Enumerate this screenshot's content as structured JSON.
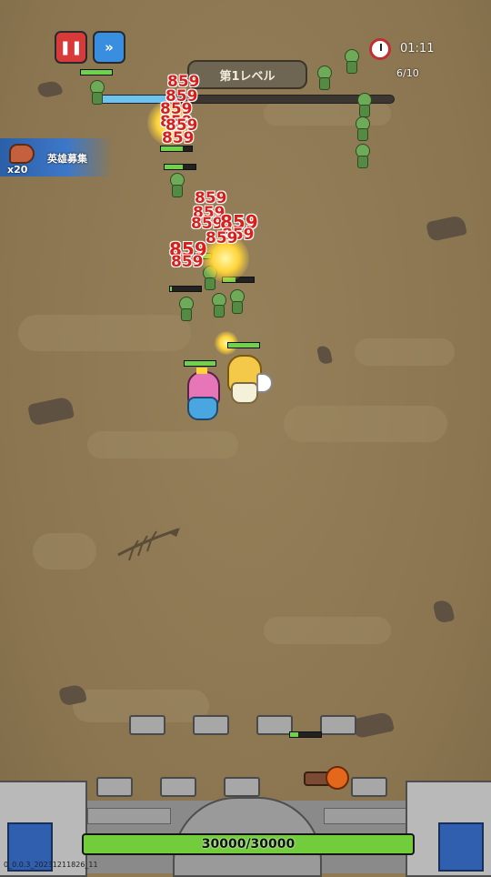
{
  "hud": {
    "pause_icon": "pause-icon",
    "speed_icon": "fast-forward-icon",
    "level_title": "第1レベル",
    "timer": "01:11",
    "wave": "6/10",
    "wave_progress_fraction": 0.27
  },
  "recruit": {
    "label": "英雄募集",
    "count": "x20",
    "icon": "meat-icon"
  },
  "damage_numbers": [
    "859",
    "859",
    "859",
    "859",
    "859",
    "859",
    "859",
    "859",
    "859",
    "859",
    "859",
    "859",
    "859",
    "859"
  ],
  "castle": {
    "hp_text": "30000/30000",
    "hp_fraction": 1.0
  },
  "version": "0_0.0.3_20231211826_11",
  "colors": {
    "field": "#8f7a54",
    "damage": "#d7201c",
    "hp_green": "#72cc3c",
    "pause_red": "#d83a3a",
    "speed_blue": "#3a8ee0"
  }
}
